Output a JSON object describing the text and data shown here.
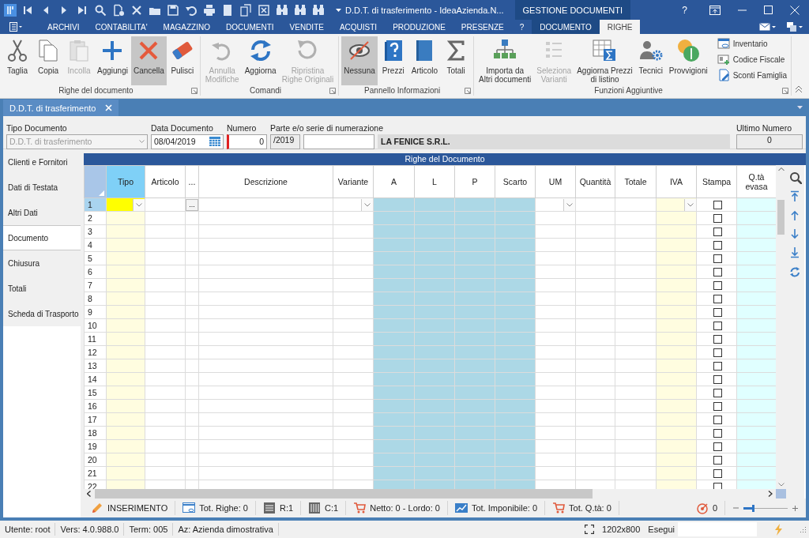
{
  "window": {
    "title": "D.D.T. di trasferimento - IdeaAzienda.N...",
    "context_group": "GESTIONE DOCUMENTI",
    "help_button": "?"
  },
  "ribbon_tabs": [
    {
      "label": "ARCHIVI",
      "selected": false,
      "context": false
    },
    {
      "label": "CONTABILITA'",
      "selected": false,
      "context": false
    },
    {
      "label": "MAGAZZINO",
      "selected": false,
      "context": false
    },
    {
      "label": "DOCUMENTI",
      "selected": false,
      "context": false
    },
    {
      "label": "VENDITE",
      "selected": false,
      "context": false
    },
    {
      "label": "ACQUISTI",
      "selected": false,
      "context": false
    },
    {
      "label": "PRODUZIONE",
      "selected": false,
      "context": false
    },
    {
      "label": "PRESENZE",
      "selected": false,
      "context": false
    },
    {
      "label": "?",
      "selected": false,
      "context": false
    },
    {
      "label": "DOCUMENTO",
      "selected": false,
      "context": true
    },
    {
      "label": "RIGHE",
      "selected": true,
      "context": true
    }
  ],
  "ribbon_groups": [
    {
      "label": "Righe del documento",
      "buttons": [
        {
          "label": "Taglia",
          "kind": "large",
          "disabled": false,
          "pressed": false
        },
        {
          "label": "Copia",
          "kind": "large",
          "disabled": false,
          "pressed": false
        },
        {
          "label": "Incolla",
          "kind": "large",
          "disabled": true,
          "pressed": false
        },
        {
          "label": "Aggiungi",
          "kind": "large",
          "disabled": false,
          "pressed": false
        },
        {
          "label": "Cancella",
          "kind": "large",
          "disabled": false,
          "pressed": true
        },
        {
          "label": "Pulisci",
          "kind": "large",
          "disabled": false,
          "pressed": false
        }
      ]
    },
    {
      "label": "Comandi",
      "buttons": [
        {
          "label": "Annulla\nModifiche",
          "kind": "large",
          "disabled": true,
          "pressed": false
        },
        {
          "label": "Aggiorna",
          "kind": "large",
          "disabled": false,
          "pressed": false
        },
        {
          "label": "Ripristina\nRighe Originali",
          "kind": "large",
          "disabled": true,
          "pressed": false
        }
      ]
    },
    {
      "label": "Pannello Informazioni",
      "buttons": [
        {
          "label": "Nessuna",
          "kind": "large",
          "disabled": false,
          "pressed": true
        },
        {
          "label": "Prezzi",
          "kind": "large",
          "disabled": false,
          "pressed": false
        },
        {
          "label": "Articolo",
          "kind": "large",
          "disabled": false,
          "pressed": false
        },
        {
          "label": "Totali",
          "kind": "large",
          "disabled": false,
          "pressed": false
        }
      ]
    },
    {
      "label": "Funzioni Aggiuntive",
      "buttons": [
        {
          "label": "Importa da\nAltri documenti",
          "kind": "large",
          "disabled": false,
          "pressed": false
        },
        {
          "label": "Seleziona\nVarianti",
          "kind": "large",
          "disabled": true,
          "pressed": false
        },
        {
          "label": "Aggiorna Prezzi\ndi listino",
          "kind": "large",
          "disabled": false,
          "pressed": false
        },
        {
          "label": "Tecnici",
          "kind": "large",
          "disabled": false,
          "pressed": false
        },
        {
          "label": "Provvigioni",
          "kind": "large",
          "disabled": false,
          "pressed": false
        },
        {
          "label": "Inventario",
          "kind": "small",
          "disabled": false,
          "pressed": false
        },
        {
          "label": "Codice Fiscale",
          "kind": "small",
          "disabled": false,
          "pressed": false
        },
        {
          "label": "Sconti Famiglia",
          "kind": "small",
          "disabled": false,
          "pressed": false
        }
      ]
    }
  ],
  "document_tabs": [
    {
      "label": "D.D.T. di trasferimento",
      "selected": true
    }
  ],
  "header": {
    "tipo_documento": {
      "label": "Tipo Documento",
      "value": "D.D.T. di trasferimento",
      "disabled": true
    },
    "data_documento": {
      "label": "Data Documento",
      "value": "08/04/2019"
    },
    "numero": {
      "label": "Numero",
      "value": "0",
      "required": true
    },
    "serie": {
      "label": "Parte e/o serie di numerazione",
      "prefix": "/2019"
    },
    "cliente": "LA FENICE S.R.L.",
    "ultimo_numero": {
      "label": "Ultimo Numero",
      "value": "0"
    }
  },
  "side_nav": [
    {
      "label": "Clienti e Fornitori",
      "selected": false
    },
    {
      "label": "Dati di Testata",
      "selected": false
    },
    {
      "label": "Altri Dati",
      "selected": false
    },
    {
      "label": "Documento",
      "selected": true
    },
    {
      "label": "Chiusura",
      "selected": false
    },
    {
      "label": "Totali",
      "selected": false
    },
    {
      "label": "Scheda di Trasporto",
      "selected": false
    }
  ],
  "grid": {
    "title": "Righe del Documento",
    "columns": [
      {
        "label": "Tipo",
        "selected": true,
        "kind": "dropdown",
        "color": "#fffde0"
      },
      {
        "label": "Articolo",
        "selected": false,
        "kind": "text",
        "color": "#ffffff"
      },
      {
        "label": "...",
        "selected": false,
        "kind": "button",
        "button_text": "...",
        "color": "#ffffff"
      },
      {
        "label": "Descrizione",
        "selected": false,
        "kind": "text",
        "color": "#ffffff"
      },
      {
        "label": "Variante",
        "selected": false,
        "kind": "dropdown",
        "color": "#ffffff"
      },
      {
        "label": "A",
        "selected": false,
        "kind": "text",
        "color": "#acd8e6"
      },
      {
        "label": "L",
        "selected": false,
        "kind": "text",
        "color": "#acd8e6"
      },
      {
        "label": "P",
        "selected": false,
        "kind": "text",
        "color": "#acd8e6"
      },
      {
        "label": "Scarto",
        "selected": false,
        "kind": "text",
        "color": "#acd8e6"
      },
      {
        "label": "UM",
        "selected": false,
        "kind": "dropdown",
        "color": "#ffffff"
      },
      {
        "label": "Quantità",
        "selected": false,
        "kind": "text",
        "color": "#ffffff"
      },
      {
        "label": "Totale",
        "selected": false,
        "kind": "text",
        "color": "#ffffff"
      },
      {
        "label": "IVA",
        "selected": false,
        "kind": "dropdown",
        "color": "#fffde0"
      },
      {
        "label": "Stampa",
        "selected": false,
        "kind": "checkbox",
        "color": "#ffffff"
      },
      {
        "label": "Q.tà\nevasa",
        "selected": false,
        "kind": "text",
        "color": "#e0ffff"
      }
    ],
    "rows": [
      {
        "number": "1",
        "selected": true,
        "checked": false
      },
      {
        "number": "2",
        "selected": false,
        "checked": false
      },
      {
        "number": "3",
        "selected": false,
        "checked": false
      },
      {
        "number": "4",
        "selected": false,
        "checked": false
      },
      {
        "number": "5",
        "selected": false,
        "checked": false
      },
      {
        "number": "6",
        "selected": false,
        "checked": false
      },
      {
        "number": "7",
        "selected": false,
        "checked": false
      },
      {
        "number": "8",
        "selected": false,
        "checked": false
      },
      {
        "number": "9",
        "selected": false,
        "checked": false
      },
      {
        "number": "10",
        "selected": false,
        "checked": false
      },
      {
        "number": "11",
        "selected": false,
        "checked": false
      },
      {
        "number": "12",
        "selected": false,
        "checked": false
      },
      {
        "number": "13",
        "selected": false,
        "checked": false
      },
      {
        "number": "14",
        "selected": false,
        "checked": false
      },
      {
        "number": "15",
        "selected": false,
        "checked": false
      },
      {
        "number": "16",
        "selected": false,
        "checked": false
      },
      {
        "number": "17",
        "selected": false,
        "checked": false
      },
      {
        "number": "18",
        "selected": false,
        "checked": false
      },
      {
        "number": "19",
        "selected": false,
        "checked": false
      },
      {
        "number": "20",
        "selected": false,
        "checked": false
      },
      {
        "number": "21",
        "selected": false,
        "checked": false
      },
      {
        "number": "22",
        "selected": false,
        "checked": false
      }
    ]
  },
  "grid_status": {
    "items": [
      "INSERIMENTO",
      "Tot. Righe: 0",
      "R:1",
      "C:1",
      "Netto: 0 - Lordo: 0",
      "Tot. Imponibile: 0",
      "Tot. Q.tà: 0"
    ],
    "counter": "0",
    "zoom": {
      "level": 0.25
    }
  },
  "status_bar": {
    "items": [
      "Utente: root",
      "Vers: 4.0.988.0",
      "Term: 005",
      "Az: Azienda dimostrativa"
    ],
    "resolution": "1202x800",
    "run_label": "Esegui"
  }
}
